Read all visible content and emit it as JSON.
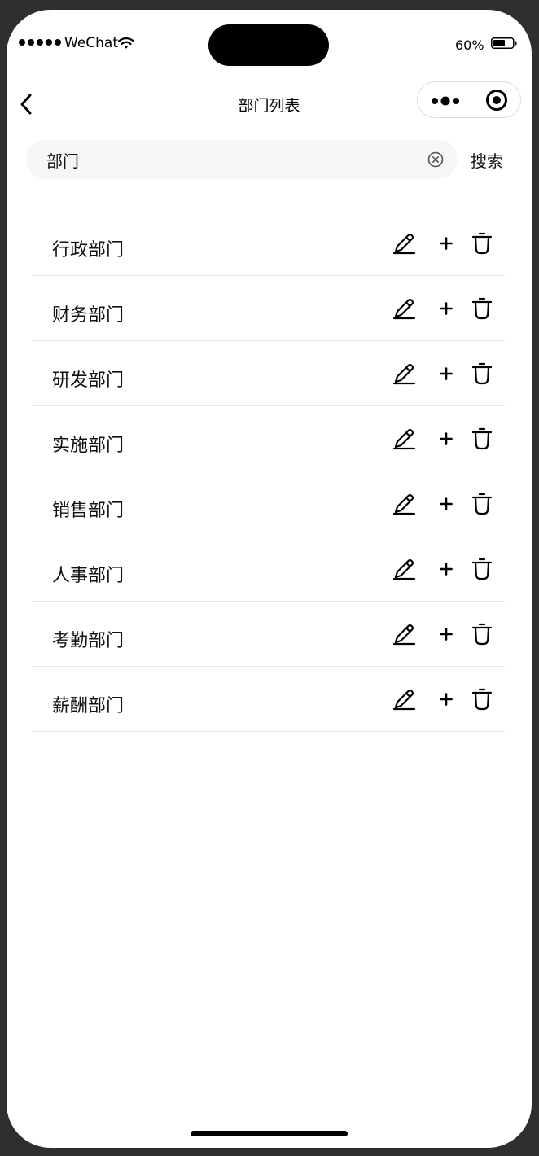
{
  "status_bar": {
    "carrier": "WeChat",
    "battery_percent": "60%",
    "battery_level": 0.6
  },
  "nav": {
    "title": "部门列表",
    "back_icon": "chevron-left-icon",
    "more_icon": "more-dots-icon",
    "close_icon": "target-circle-icon"
  },
  "search": {
    "value": "部门",
    "placeholder": "",
    "clear_icon": "clear-circle-icon",
    "button_label": "搜索"
  },
  "departments": [
    {
      "name": "行政部门"
    },
    {
      "name": "财务部门"
    },
    {
      "name": "研发部门"
    },
    {
      "name": "实施部门"
    },
    {
      "name": "销售部门"
    },
    {
      "name": "人事部门"
    },
    {
      "name": "考勤部门"
    },
    {
      "name": "薪酬部门"
    }
  ],
  "row_action_icons": [
    "edit-pencil-icon",
    "add-plus-icon",
    "delete-trash-icon"
  ],
  "colors": {
    "text": "#111111",
    "search_bg": "#f6f6f6",
    "divider": "#e6e6e6",
    "frame": "#2f2f2f"
  }
}
